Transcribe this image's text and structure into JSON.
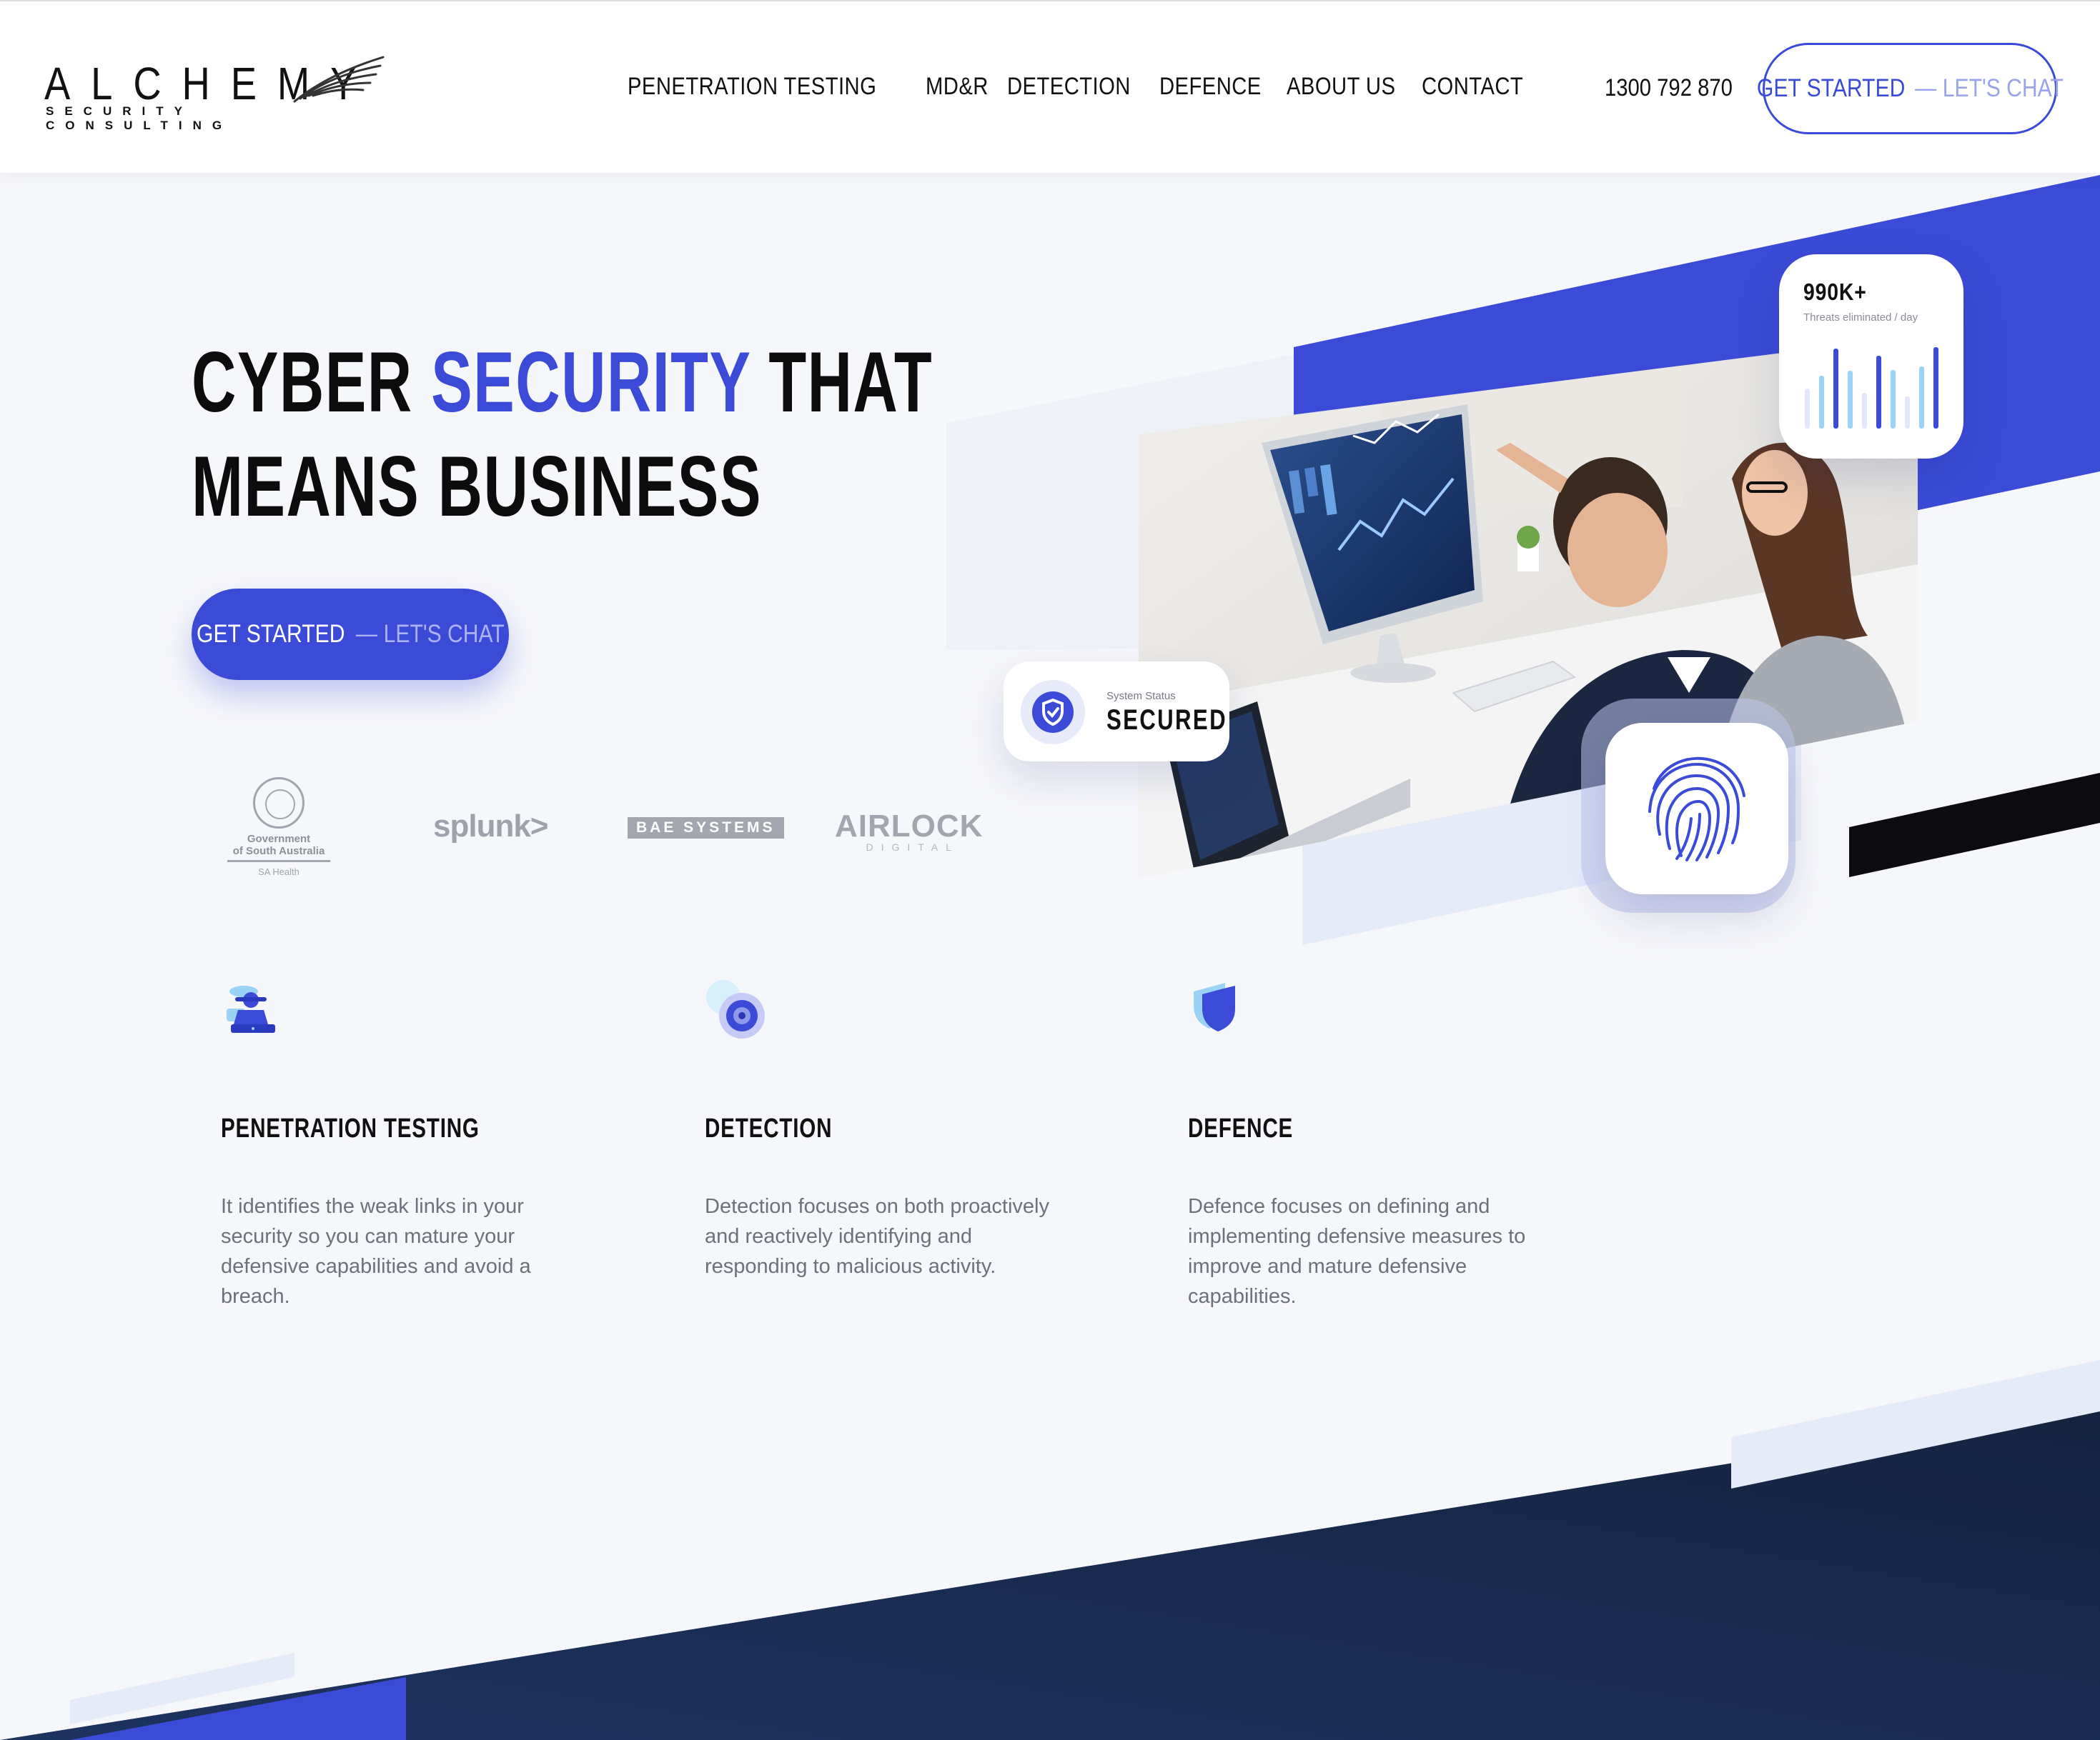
{
  "brand": {
    "logo_word": "ALCHEMY",
    "logo_sub": "SECURITY CONSULTING",
    "accent_color": "#3b4bd8",
    "dark_color": "#142646"
  },
  "nav": {
    "items": [
      "PENETRATION TESTING",
      "MD&R",
      "DETECTION",
      "DEFENCE",
      "ABOUT US",
      "CONTACT"
    ],
    "phone": "1300 792 870",
    "cta_primary": "GET STARTED",
    "cta_dash": "—",
    "cta_secondary": "LET'S CHAT"
  },
  "hero": {
    "title_part1": "CYBER ",
    "title_accent": "SECURITY",
    "title_part2": " THAT",
    "title_line2": "MEANS BUSINESS",
    "cta_primary": "GET STARTED",
    "cta_dash": "—",
    "cta_secondary": "LET'S CHAT"
  },
  "clients": {
    "sa_line1": "Government",
    "sa_line2": "of South Australia",
    "sa_line3": "SA Health",
    "splunk": "splunk>",
    "bae": "BAE SYSTEMS",
    "airlock": "AIRLOCK",
    "airlock_sub": "DIGITAL"
  },
  "stat_card": {
    "value": "990K+",
    "label": "Threats eliminated / day",
    "bar_levels": [
      0.45,
      0.6,
      0.9,
      0.65,
      0.4,
      0.82,
      0.66,
      0.36,
      0.7,
      0.92
    ]
  },
  "status_card": {
    "small": "System Status",
    "big": "SECURED"
  },
  "features": [
    {
      "title": "PENETRATION TESTING",
      "desc": "It identifies the weak links in your security so you can mature your defensive capabilities and avoid a breach.",
      "icon": "hacker-laptop-icon"
    },
    {
      "title": "DETECTION",
      "desc": "Detection focuses on both proactively and reactively identifying and responding to malicious activity.",
      "icon": "radar-target-icon"
    },
    {
      "title": "DEFENCE",
      "desc": "Defence focuses on defining and implementing defensive measures to improve and mature defensive capabilities.",
      "icon": "shield-icon"
    }
  ]
}
